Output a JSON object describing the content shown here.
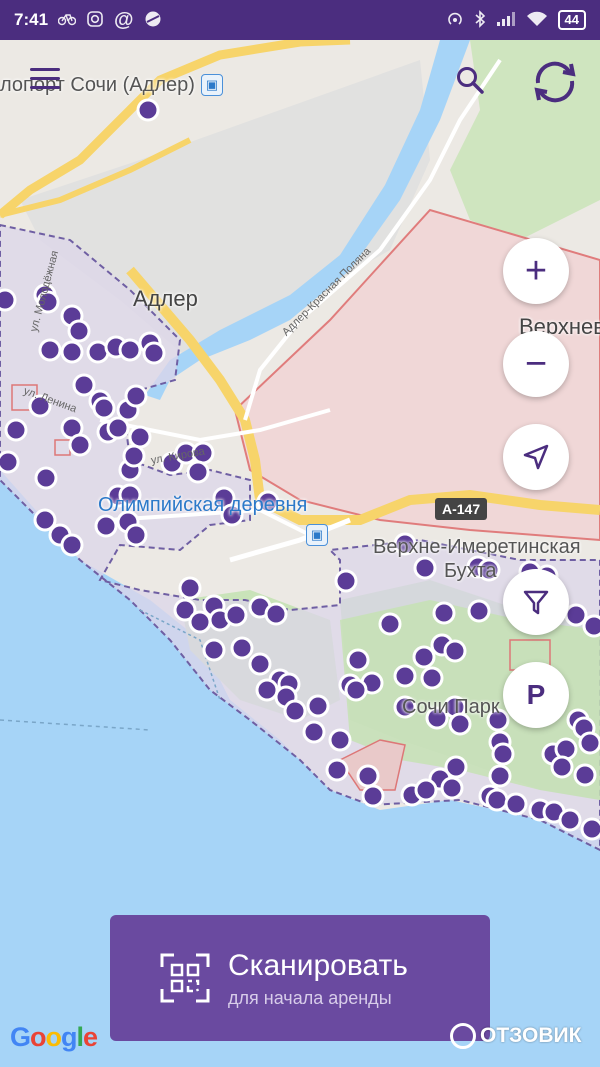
{
  "status_bar": {
    "time": "7:41",
    "battery": "44"
  },
  "map": {
    "labels": {
      "airport": "лопорт Сочи (Адлер)",
      "adler": "Адлер",
      "verkhnev": "Верхнев",
      "olympic_village": "Олимпийская деревня",
      "verkhne_imeretinskaya": "Верхне-Имеретинская",
      "bay": "Бухта",
      "park": "Сочи Парк",
      "road_name": "Адлер-Красная Поляна",
      "road_number": "А-147",
      "street1": "ул. Молодёжная",
      "street2": "ул. Ленина",
      "street3": "ул. Кирова"
    }
  },
  "buttons": {
    "zoom_in": "+",
    "zoom_out": "−",
    "parking": "P"
  },
  "scan": {
    "title": "Сканировать",
    "subtitle": "для начала аренды"
  },
  "footer": {
    "google": "Google",
    "watermark": "ОТЗОВИК"
  },
  "colors": {
    "brand": "#4b2d7f",
    "scan": "#6a4aa0",
    "marker": "#5b3c97",
    "water": "#a6d4f7"
  }
}
